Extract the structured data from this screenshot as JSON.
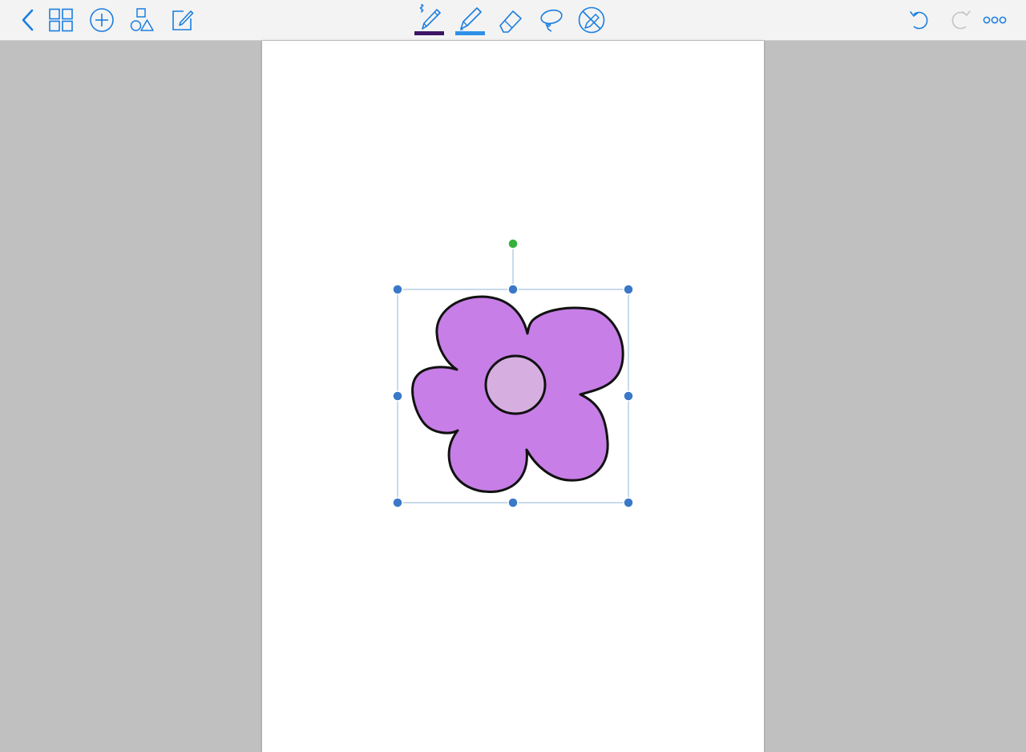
{
  "toolbar": {
    "left_icons": [
      "back-chevron-icon",
      "thumbnails-grid-icon",
      "add-circle-icon",
      "shapes-icon",
      "edit-note-icon"
    ],
    "center_tools": [
      {
        "name": "bluetooth-pen-tool",
        "icon": "pen-icon",
        "underline_color": "#3d1466",
        "selected": false
      },
      {
        "name": "highlighter-tool",
        "icon": "highlighter-icon",
        "underline_color": "#2e90e8",
        "selected": true
      },
      {
        "name": "eraser-tool",
        "icon": "eraser-icon"
      },
      {
        "name": "lasso-tool",
        "icon": "lasso-icon"
      },
      {
        "name": "disable-pen-tool",
        "icon": "pen-disabled-icon"
      }
    ],
    "right_icons": [
      "undo-icon",
      "redo-icon",
      "more-icon"
    ],
    "accent_color": "#1a7ee0",
    "disabled_color": "#c4c4c4"
  },
  "canvas": {
    "background_color": "#c0c0c0",
    "page_color": "#ffffff",
    "drawing": {
      "type": "flower-shape",
      "petal_color": "#c77ee6",
      "center_color": "#d6afe0",
      "outline_color": "#111111",
      "selected": true,
      "selection_color": "#a3c2e0",
      "handle_color": "#3a78c8",
      "rotate_handle_color": "#35b13d"
    }
  }
}
